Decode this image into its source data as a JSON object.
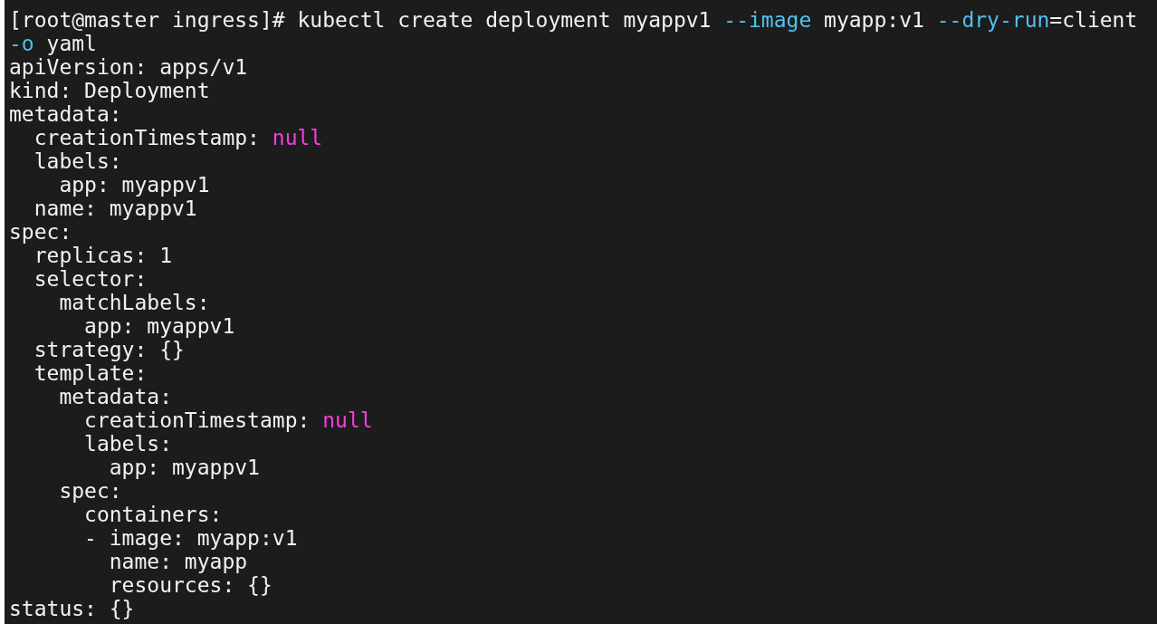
{
  "terminal": {
    "lines": [
      [
        {
          "kind": "plain",
          "text": "[root@master ingress]# kubectl create deployment myappv1 "
        },
        {
          "kind": "flag",
          "text": "--image"
        },
        {
          "kind": "plain",
          "text": " myapp:v1 "
        },
        {
          "kind": "flag",
          "text": "--dry-run"
        },
        {
          "kind": "plain",
          "text": "=client"
        }
      ],
      [
        {
          "kind": "flag",
          "text": "-o"
        },
        {
          "kind": "plain",
          "text": " yaml"
        }
      ],
      [
        {
          "kind": "plain",
          "text": "apiVersion: apps/v1"
        }
      ],
      [
        {
          "kind": "plain",
          "text": "kind: Deployment"
        }
      ],
      [
        {
          "kind": "plain",
          "text": "metadata:"
        }
      ],
      [
        {
          "kind": "plain",
          "text": "  creationTimestamp: "
        },
        {
          "kind": "null",
          "text": "null"
        }
      ],
      [
        {
          "kind": "plain",
          "text": "  labels:"
        }
      ],
      [
        {
          "kind": "plain",
          "text": "    app: myappv1"
        }
      ],
      [
        {
          "kind": "plain",
          "text": "  name: myappv1"
        }
      ],
      [
        {
          "kind": "plain",
          "text": "spec:"
        }
      ],
      [
        {
          "kind": "plain",
          "text": "  replicas: 1"
        }
      ],
      [
        {
          "kind": "plain",
          "text": "  selector:"
        }
      ],
      [
        {
          "kind": "plain",
          "text": "    matchLabels:"
        }
      ],
      [
        {
          "kind": "plain",
          "text": "      app: myappv1"
        }
      ],
      [
        {
          "kind": "plain",
          "text": "  strategy: {}"
        }
      ],
      [
        {
          "kind": "plain",
          "text": "  template:"
        }
      ],
      [
        {
          "kind": "plain",
          "text": "    metadata:"
        }
      ],
      [
        {
          "kind": "plain",
          "text": "      creationTimestamp: "
        },
        {
          "kind": "null",
          "text": "null"
        }
      ],
      [
        {
          "kind": "plain",
          "text": "      labels:"
        }
      ],
      [
        {
          "kind": "plain",
          "text": "        app: myappv1"
        }
      ],
      [
        {
          "kind": "plain",
          "text": "    spec:"
        }
      ],
      [
        {
          "kind": "plain",
          "text": "      containers:"
        }
      ],
      [
        {
          "kind": "plain",
          "text": "      - image: myapp:v1"
        }
      ],
      [
        {
          "kind": "plain",
          "text": "        name: myapp"
        }
      ],
      [
        {
          "kind": "plain",
          "text": "        resources: {}"
        }
      ],
      [
        {
          "kind": "plain",
          "text": "status: {}"
        }
      ]
    ]
  }
}
